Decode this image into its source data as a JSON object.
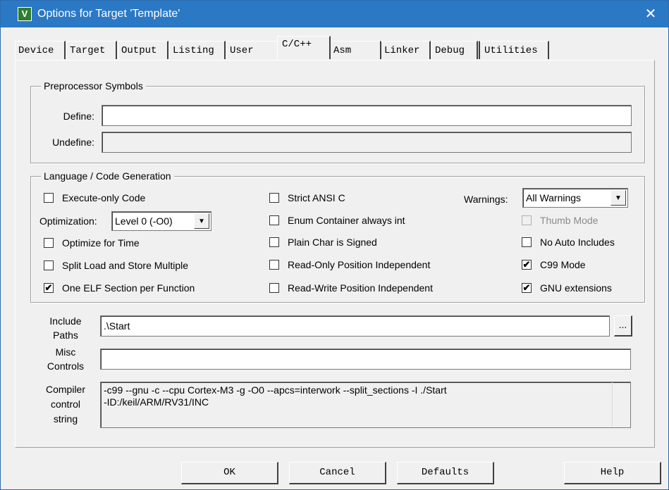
{
  "window": {
    "title": "Options for Target 'Template'",
    "app_icon": "keil-uvision-icon",
    "close_glyph": "✕"
  },
  "tabs": [
    {
      "label": "Device"
    },
    {
      "label": "Target"
    },
    {
      "label": "Output"
    },
    {
      "label": "Listing"
    },
    {
      "label": "User"
    },
    {
      "label": "C/C++"
    },
    {
      "label": "Asm"
    },
    {
      "label": "Linker"
    },
    {
      "label": "Debug"
    },
    {
      "label": "Utilities"
    }
  ],
  "preprocessor": {
    "group_title": "Preprocessor Symbols",
    "define_label": "Define:",
    "define_value": "",
    "undefine_label": "Undefine:",
    "undefine_value": ""
  },
  "language": {
    "group_title": "Language / Code Generation",
    "execute_only": {
      "label": "Execute-only Code",
      "checked": false
    },
    "optimization_label": "Optimization:",
    "optimization_value": "Level 0 (-O0)",
    "optimize_time": {
      "label": "Optimize for Time",
      "checked": false
    },
    "split_load": {
      "label": "Split Load and Store Multiple",
      "checked": false
    },
    "one_elf": {
      "label": "One ELF Section per Function",
      "checked": true
    },
    "strict_ansi": {
      "label": "Strict ANSI C",
      "checked": false
    },
    "enum_container": {
      "label": "Enum Container always int",
      "checked": false
    },
    "plain_char": {
      "label": "Plain Char is Signed",
      "checked": false
    },
    "ro_pi": {
      "label": "Read-Only Position Independent",
      "checked": false
    },
    "rw_pi": {
      "label": "Read-Write Position Independent",
      "checked": false
    },
    "warnings_label": "Warnings:",
    "warnings_value": "All Warnings",
    "thumb_mode": {
      "label": "Thumb Mode",
      "checked": false,
      "disabled": true
    },
    "no_auto_includes": {
      "label": "No Auto Includes",
      "checked": false
    },
    "c99_mode": {
      "label": "C99 Mode",
      "checked": true
    },
    "gnu_ext": {
      "label": "GNU extensions",
      "checked": true
    },
    "check_glyph": "✔",
    "dropdown_glyph": "▼"
  },
  "paths": {
    "include_label_1": "Include",
    "include_label_2": "Paths",
    "include_value": ".\\Start",
    "browse_label": "...",
    "misc_label_1": "Misc",
    "misc_label_2": "Controls",
    "misc_value": "",
    "ccs_label_1": "Compiler",
    "ccs_label_2": "control",
    "ccs_label_3": "string",
    "ccs_line_1": "-c99 --gnu -c --cpu Cortex-M3 -g -O0 --apcs=interwork --split_sections -I ./Start",
    "ccs_line_2": "-ID:/keil/ARM/RV31/INC"
  },
  "buttons": {
    "ok": "OK",
    "cancel": "Cancel",
    "defaults": "Defaults",
    "help": "Help"
  }
}
